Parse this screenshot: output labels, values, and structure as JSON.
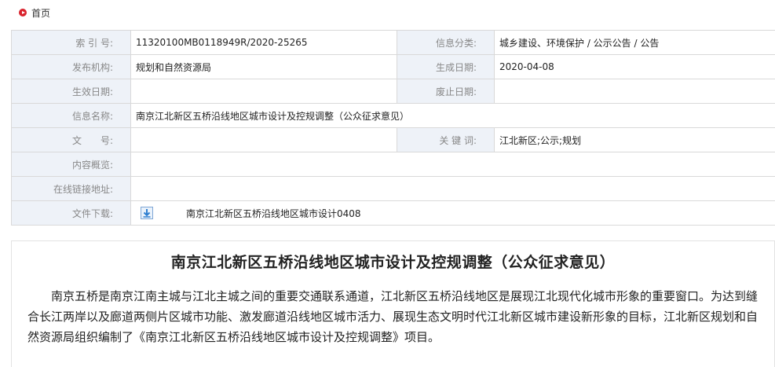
{
  "breadcrumb": {
    "home": "首页"
  },
  "meta": {
    "index_label": "索 引 号:",
    "index_value": "11320100MB0118949R/2020-25265",
    "category_label": "信息分类:",
    "category_value": "城乡建设、环境保护 / 公示公告 / 公告",
    "publisher_label": "发布机构:",
    "publisher_value": "规划和自然资源局",
    "created_label": "生成日期:",
    "created_value": "2020-04-08",
    "effective_label": "生效日期:",
    "effective_value": "",
    "expired_label": "废止日期:",
    "expired_value": "",
    "name_label": "信息名称:",
    "name_value": "南京江北新区五桥沿线地区城市设计及控规调整（公众征求意见）",
    "docno_label": "文　　号:",
    "docno_value": "",
    "keywords_label": "关 键 词:",
    "keywords_value": "江北新区;公示;规划",
    "summary_label": "内容概览:",
    "summary_value": "",
    "link_label": "在线链接地址:",
    "link_value": "",
    "download_label": "文件下载:",
    "download_value": "南京江北新区五桥沿线地区城市设计0408"
  },
  "article": {
    "title": "南京江北新区五桥沿线地区城市设计及控规调整（公众征求意见）",
    "body": "南京五桥是南京江南主城与江北主城之间的重要交通联系通道，江北新区五桥沿线地区是展现江北现代化城市形象的重要窗口。为达到缝合长江两岸以及廊道两侧片区城市功能、激发廊道沿线地区城市活力、展现生态文明时代江北新区城市建设新形象的目标，江北新区规划和自然资源局组织编制了《南京江北新区五桥沿线地区城市设计及控规调整》项目。"
  },
  "colors": {
    "label_bg": "#eef2f8",
    "border": "#d9d9d9",
    "home_icon": "#d9232d",
    "download_icon": "#2f7fd0"
  }
}
